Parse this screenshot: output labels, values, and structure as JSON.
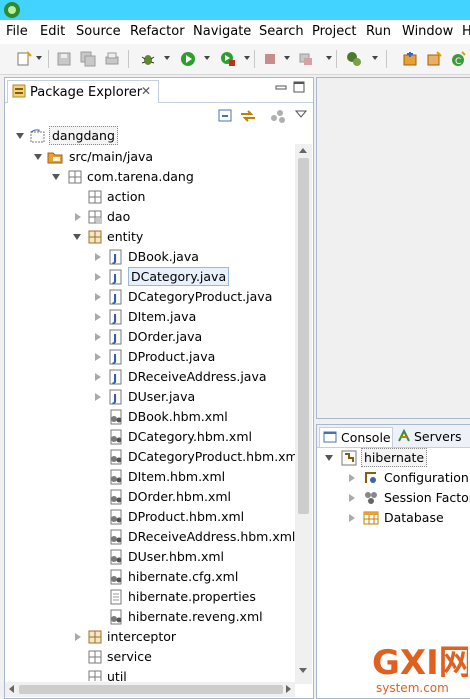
{
  "menu": [
    "File",
    "Edit",
    "Source",
    "Refactor",
    "Navigate",
    "Search",
    "Project",
    "Run",
    "Window",
    "H"
  ],
  "package_explorer": {
    "title": "Package Explorer",
    "close_glyph": "✕",
    "tree": {
      "project": "dangdang",
      "source_folder": "src/main/java",
      "package": "com.tarena.dang",
      "subpackages": [
        "action",
        "dao",
        "entity"
      ],
      "entity_files": [
        "DBook.java",
        "DCategory.java",
        "DCategoryProduct.java",
        "DItem.java",
        "DOrder.java",
        "DProduct.java",
        "DReceiveAddress.java",
        "DUser.java",
        "DBook.hbm.xml",
        "DCategory.hbm.xml",
        "DCategoryProduct.hbm.xml",
        "DItem.hbm.xml",
        "DOrder.hbm.xml",
        "DProduct.hbm.xml",
        "DReceiveAddress.hbm.xml",
        "DUser.hbm.xml",
        "hibernate.cfg.xml",
        "hibernate.properties",
        "hibernate.reveng.xml"
      ],
      "more_packages": [
        "interceptor",
        "service",
        "util"
      ]
    }
  },
  "bottom_panel": {
    "tabs": [
      "Console",
      "Servers"
    ],
    "tree": {
      "root": "hibernate",
      "children": [
        "Configuration",
        "Session Factory",
        "Database"
      ]
    }
  },
  "watermark": {
    "main": "GXI网",
    "sub": "system.com"
  }
}
